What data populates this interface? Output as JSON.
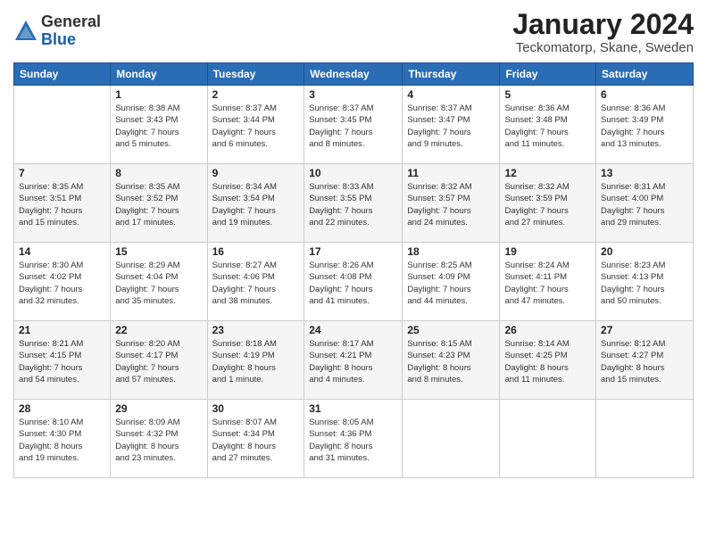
{
  "header": {
    "logo_general": "General",
    "logo_blue": "Blue",
    "month_title": "January 2024",
    "location": "Teckomatorp, Skane, Sweden"
  },
  "days_of_week": [
    "Sunday",
    "Monday",
    "Tuesday",
    "Wednesday",
    "Thursday",
    "Friday",
    "Saturday"
  ],
  "weeks": [
    [
      {
        "day": "",
        "info": ""
      },
      {
        "day": "1",
        "info": "Sunrise: 8:38 AM\nSunset: 3:43 PM\nDaylight: 7 hours\nand 5 minutes."
      },
      {
        "day": "2",
        "info": "Sunrise: 8:37 AM\nSunset: 3:44 PM\nDaylight: 7 hours\nand 6 minutes."
      },
      {
        "day": "3",
        "info": "Sunrise: 8:37 AM\nSunset: 3:45 PM\nDaylight: 7 hours\nand 8 minutes."
      },
      {
        "day": "4",
        "info": "Sunrise: 8:37 AM\nSunset: 3:47 PM\nDaylight: 7 hours\nand 9 minutes."
      },
      {
        "day": "5",
        "info": "Sunrise: 8:36 AM\nSunset: 3:48 PM\nDaylight: 7 hours\nand 11 minutes."
      },
      {
        "day": "6",
        "info": "Sunrise: 8:36 AM\nSunset: 3:49 PM\nDaylight: 7 hours\nand 13 minutes."
      }
    ],
    [
      {
        "day": "7",
        "info": "Sunrise: 8:35 AM\nSunset: 3:51 PM\nDaylight: 7 hours\nand 15 minutes."
      },
      {
        "day": "8",
        "info": "Sunrise: 8:35 AM\nSunset: 3:52 PM\nDaylight: 7 hours\nand 17 minutes."
      },
      {
        "day": "9",
        "info": "Sunrise: 8:34 AM\nSunset: 3:54 PM\nDaylight: 7 hours\nand 19 minutes."
      },
      {
        "day": "10",
        "info": "Sunrise: 8:33 AM\nSunset: 3:55 PM\nDaylight: 7 hours\nand 22 minutes."
      },
      {
        "day": "11",
        "info": "Sunrise: 8:32 AM\nSunset: 3:57 PM\nDaylight: 7 hours\nand 24 minutes."
      },
      {
        "day": "12",
        "info": "Sunrise: 8:32 AM\nSunset: 3:59 PM\nDaylight: 7 hours\nand 27 minutes."
      },
      {
        "day": "13",
        "info": "Sunrise: 8:31 AM\nSunset: 4:00 PM\nDaylight: 7 hours\nand 29 minutes."
      }
    ],
    [
      {
        "day": "14",
        "info": "Sunrise: 8:30 AM\nSunset: 4:02 PM\nDaylight: 7 hours\nand 32 minutes."
      },
      {
        "day": "15",
        "info": "Sunrise: 8:29 AM\nSunset: 4:04 PM\nDaylight: 7 hours\nand 35 minutes."
      },
      {
        "day": "16",
        "info": "Sunrise: 8:27 AM\nSunset: 4:06 PM\nDaylight: 7 hours\nand 38 minutes."
      },
      {
        "day": "17",
        "info": "Sunrise: 8:26 AM\nSunset: 4:08 PM\nDaylight: 7 hours\nand 41 minutes."
      },
      {
        "day": "18",
        "info": "Sunrise: 8:25 AM\nSunset: 4:09 PM\nDaylight: 7 hours\nand 44 minutes."
      },
      {
        "day": "19",
        "info": "Sunrise: 8:24 AM\nSunset: 4:11 PM\nDaylight: 7 hours\nand 47 minutes."
      },
      {
        "day": "20",
        "info": "Sunrise: 8:23 AM\nSunset: 4:13 PM\nDaylight: 7 hours\nand 50 minutes."
      }
    ],
    [
      {
        "day": "21",
        "info": "Sunrise: 8:21 AM\nSunset: 4:15 PM\nDaylight: 7 hours\nand 54 minutes."
      },
      {
        "day": "22",
        "info": "Sunrise: 8:20 AM\nSunset: 4:17 PM\nDaylight: 7 hours\nand 57 minutes."
      },
      {
        "day": "23",
        "info": "Sunrise: 8:18 AM\nSunset: 4:19 PM\nDaylight: 8 hours\nand 1 minute."
      },
      {
        "day": "24",
        "info": "Sunrise: 8:17 AM\nSunset: 4:21 PM\nDaylight: 8 hours\nand 4 minutes."
      },
      {
        "day": "25",
        "info": "Sunrise: 8:15 AM\nSunset: 4:23 PM\nDaylight: 8 hours\nand 8 minutes."
      },
      {
        "day": "26",
        "info": "Sunrise: 8:14 AM\nSunset: 4:25 PM\nDaylight: 8 hours\nand 11 minutes."
      },
      {
        "day": "27",
        "info": "Sunrise: 8:12 AM\nSunset: 4:27 PM\nDaylight: 8 hours\nand 15 minutes."
      }
    ],
    [
      {
        "day": "28",
        "info": "Sunrise: 8:10 AM\nSunset: 4:30 PM\nDaylight: 8 hours\nand 19 minutes."
      },
      {
        "day": "29",
        "info": "Sunrise: 8:09 AM\nSunset: 4:32 PM\nDaylight: 8 hours\nand 23 minutes."
      },
      {
        "day": "30",
        "info": "Sunrise: 8:07 AM\nSunset: 4:34 PM\nDaylight: 8 hours\nand 27 minutes."
      },
      {
        "day": "31",
        "info": "Sunrise: 8:05 AM\nSunset: 4:36 PM\nDaylight: 8 hours\nand 31 minutes."
      },
      {
        "day": "",
        "info": ""
      },
      {
        "day": "",
        "info": ""
      },
      {
        "day": "",
        "info": ""
      }
    ]
  ]
}
